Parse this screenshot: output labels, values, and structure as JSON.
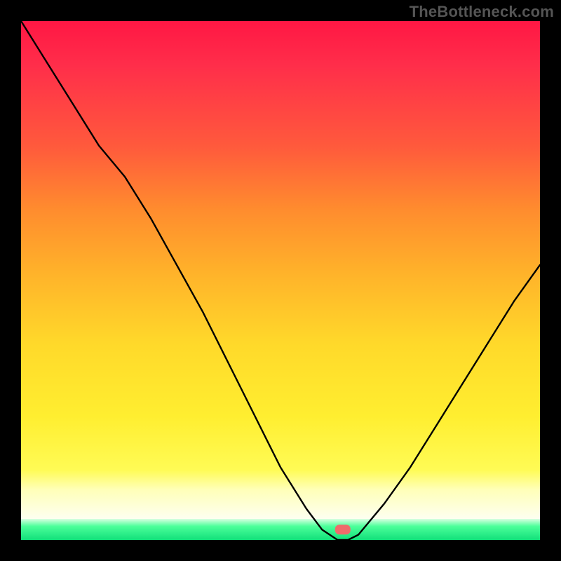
{
  "watermark": "TheBottleneck.com",
  "chart_data": {
    "type": "line",
    "title": "",
    "xlabel": "",
    "ylabel": "",
    "x": [
      0.0,
      0.05,
      0.1,
      0.15,
      0.2,
      0.25,
      0.3,
      0.35,
      0.4,
      0.45,
      0.5,
      0.55,
      0.58,
      0.61,
      0.63,
      0.65,
      0.7,
      0.75,
      0.8,
      0.85,
      0.9,
      0.95,
      1.0
    ],
    "y": [
      1.0,
      0.92,
      0.84,
      0.76,
      0.7,
      0.62,
      0.53,
      0.44,
      0.34,
      0.24,
      0.14,
      0.06,
      0.02,
      0.0,
      0.0,
      0.01,
      0.07,
      0.14,
      0.22,
      0.3,
      0.38,
      0.46,
      0.53
    ],
    "xlim": [
      0,
      1
    ],
    "ylim": [
      0,
      1
    ],
    "marker": {
      "x": 0.62,
      "y": 0.02,
      "color": "#ef6b6b"
    },
    "background": {
      "top_color": "#ff1744",
      "mid_color": "#ffd92a",
      "bottom_color": "#11e07a"
    }
  }
}
